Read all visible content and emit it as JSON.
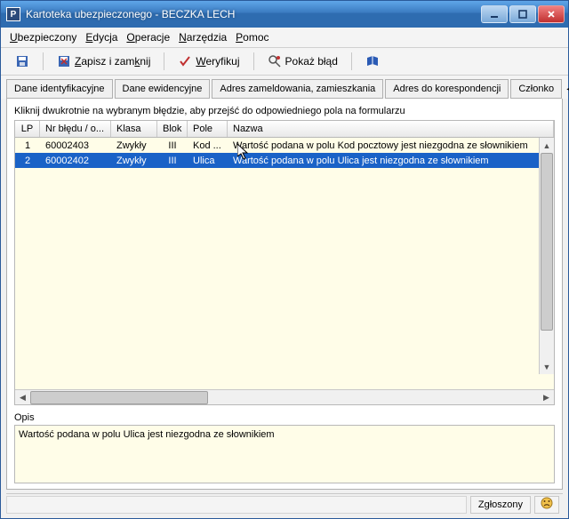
{
  "window": {
    "title": "Kartoteka ubezpieczonego  - BECZKA LECH"
  },
  "menu": {
    "ubezpieczony": "Ubezpieczony",
    "edycja": "Edycja",
    "operacje": "Operacje",
    "narzedzia": "Narzędzia",
    "pomoc": "Pomoc"
  },
  "toolbar": {
    "save_close": "Zapisz i zamknij",
    "verify": "Weryfikuj",
    "show_error": "Pokaż błąd"
  },
  "tabs": {
    "t0": "Dane identyfikacyjne",
    "t1": "Dane ewidencyjne",
    "t2": "Adres zameldowania, zamieszkania",
    "t3": "Adres do korespondencji",
    "t4": "Członko"
  },
  "hint": "Kliknij dwukrotnie na wybranym błędzie, aby przejść do odpowiedniego pola na formularzu",
  "table": {
    "headers": {
      "lp": "LP",
      "nr": "Nr błędu / o...",
      "klasa": "Klasa",
      "blok": "Blok",
      "pole": "Pole",
      "nazwa": "Nazwa"
    },
    "rows": [
      {
        "lp": "1",
        "nr": "60002403",
        "klasa": "Zwykły",
        "blok": "III",
        "pole": "Kod ...",
        "nazwa": "Wartość podana w polu Kod pocztowy jest niezgodna ze słownikiem",
        "selected": false
      },
      {
        "lp": "2",
        "nr": "60002402",
        "klasa": "Zwykły",
        "blok": "III",
        "pole": "Ulica",
        "nazwa": "Wartość podana w polu Ulica jest niezgodna ze słownikiem",
        "selected": true
      }
    ]
  },
  "opis": {
    "label": "Opis",
    "text": "Wartość podana w polu Ulica jest niezgodna ze słownikiem"
  },
  "status": {
    "zgloszony": "Zgłoszony"
  }
}
